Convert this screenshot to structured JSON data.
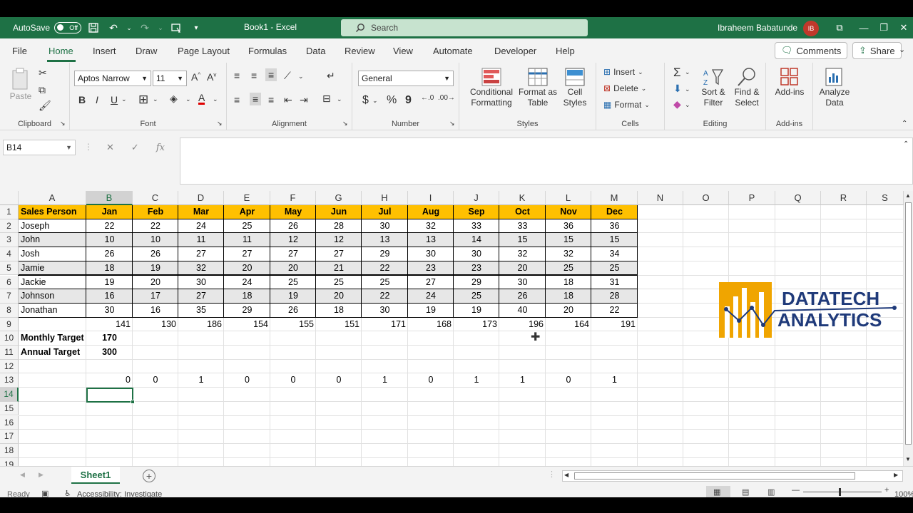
{
  "titlebar": {
    "autosave_label": "AutoSave",
    "autosave_state": "Off",
    "document_title": "Book1 - Excel",
    "search_placeholder": "Search",
    "user_name": "Ibraheem Babatunde",
    "user_initials": "IB"
  },
  "tabs": [
    "File",
    "Home",
    "Insert",
    "Draw",
    "Page Layout",
    "Formulas",
    "Data",
    "Review",
    "View",
    "Automate",
    "Developer",
    "Help"
  ],
  "active_tab": "Home",
  "actions": {
    "comments": "Comments",
    "share": "Share"
  },
  "ribbon": {
    "clipboard": {
      "label": "Clipboard",
      "paste": "Paste"
    },
    "font": {
      "label": "Font",
      "font_name": "Aptos Narrow",
      "font_size": "11",
      "bold": "B",
      "italic": "I",
      "underline": "U"
    },
    "alignment": {
      "label": "Alignment"
    },
    "number": {
      "label": "Number",
      "format": "General",
      "currency": "$",
      "percent": "%",
      "comma": "9"
    },
    "styles": {
      "label": "Styles",
      "conditional_1": "Conditional",
      "conditional_2": "Formatting",
      "format_table_1": "Format as",
      "format_table_2": "Table",
      "cell_styles_1": "Cell",
      "cell_styles_2": "Styles"
    },
    "cells": {
      "label": "Cells",
      "insert": "Insert",
      "delete": "Delete",
      "format": "Format"
    },
    "editing": {
      "label": "Editing",
      "sort_1": "Sort &",
      "sort_2": "Filter",
      "find_1": "Find &",
      "find_2": "Select"
    },
    "addins": {
      "label": "Add-ins",
      "addins_btn": "Add-ins"
    },
    "analyze": {
      "line1": "Analyze",
      "line2": "Data"
    }
  },
  "formula_bar": {
    "name_box": "B14",
    "fx": "fx",
    "cancel": "✕",
    "confirm": "✓",
    "value": ""
  },
  "columns": [
    "A",
    "B",
    "C",
    "D",
    "E",
    "F",
    "G",
    "H",
    "I",
    "J",
    "K",
    "L",
    "M",
    "N",
    "O",
    "P",
    "Q",
    "R",
    "S"
  ],
  "rows": [
    "1",
    "2",
    "3",
    "4",
    "5",
    "6",
    "7",
    "8",
    "9",
    "10",
    "11",
    "12",
    "13",
    "14",
    "15",
    "16",
    "17",
    "18",
    "19"
  ],
  "sheet": {
    "header": [
      "Sales Person",
      "Jan",
      "Feb",
      "Mar",
      "Apr",
      "May",
      "Jun",
      "Jul",
      "Aug",
      "Sep",
      "Oct",
      "Nov",
      "Dec"
    ],
    "data": [
      [
        "Joseph",
        "22",
        "22",
        "24",
        "25",
        "26",
        "28",
        "30",
        "32",
        "33",
        "33",
        "36",
        "36"
      ],
      [
        "John",
        "10",
        "10",
        "11",
        "11",
        "12",
        "12",
        "13",
        "13",
        "14",
        "15",
        "15",
        "15"
      ],
      [
        "Josh",
        "26",
        "26",
        "27",
        "27",
        "27",
        "27",
        "29",
        "30",
        "30",
        "32",
        "32",
        "34"
      ],
      [
        "Jamie",
        "18",
        "19",
        "32",
        "20",
        "20",
        "21",
        "22",
        "23",
        "23",
        "20",
        "25",
        "25"
      ],
      [
        "Jackie",
        "19",
        "20",
        "30",
        "24",
        "25",
        "25",
        "25",
        "27",
        "29",
        "30",
        "18",
        "31"
      ],
      [
        "Johnson",
        "16",
        "17",
        "27",
        "18",
        "19",
        "20",
        "22",
        "24",
        "25",
        "26",
        "18",
        "28"
      ],
      [
        "Jonathan",
        "30",
        "16",
        "35",
        "29",
        "26",
        "18",
        "30",
        "19",
        "19",
        "40",
        "20",
        "22"
      ]
    ],
    "totals": [
      "141",
      "130",
      "186",
      "154",
      "155",
      "151",
      "171",
      "168",
      "173",
      "196",
      "164",
      "191"
    ],
    "monthly_target_label": "Monthly Target",
    "monthly_target_value": "170",
    "annual_target_label": "Annual Target",
    "annual_target_value": "300",
    "flags": [
      "0",
      "0",
      "1",
      "0",
      "0",
      "0",
      "1",
      "0",
      "1",
      "1",
      "0",
      "1"
    ]
  },
  "logo": {
    "line1": "DATATECH",
    "line2": "ANALYTICS",
    "color_primary": "#1f3a7a",
    "color_accent": "#f0a500"
  },
  "sheet_tabs": {
    "active": "Sheet1"
  },
  "status": {
    "ready": "Ready",
    "accessibility": "Accessibility: Investigate",
    "zoom": "100%"
  },
  "colors": {
    "excel_green": "#1e7145",
    "header_fill": "#ffc000",
    "alt_row_fill": "#e7e7e7"
  }
}
